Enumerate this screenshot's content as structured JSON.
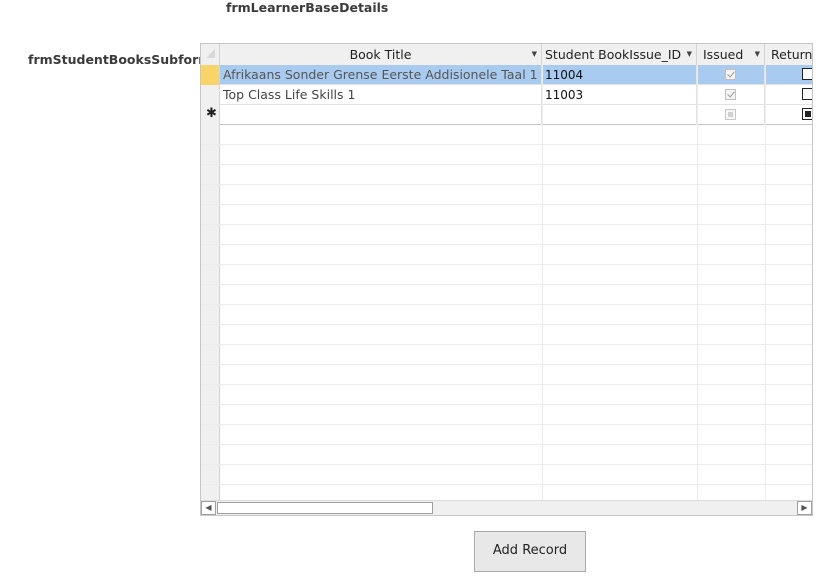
{
  "form": {
    "title": "frmLearnerBaseDetails",
    "subform_label": "frmStudentBooksSubform",
    "add_button_label": "Add Record"
  },
  "grid": {
    "columns": [
      {
        "label": "Book Title",
        "dropdown": true
      },
      {
        "label": "Student BookIssue_ID",
        "dropdown": true
      },
      {
        "label": "Issued",
        "dropdown": true
      },
      {
        "label": "Return",
        "dropdown": false
      }
    ],
    "rows": [
      {
        "book_title": "Afrikaans Sonder Grense Eerste Addisionele Taal 1",
        "issue_id": "11004",
        "issued": true,
        "returned": false,
        "selected": true
      },
      {
        "book_title": "Top Class Life Skills 1",
        "issue_id": "11003",
        "issued": true,
        "returned": false,
        "selected": false
      }
    ],
    "new_row_marker": "✱"
  },
  "colors": {
    "selected_row": "#a9cbf0",
    "current_record": "#f9d469",
    "header_bg": "#f0f0f0"
  }
}
